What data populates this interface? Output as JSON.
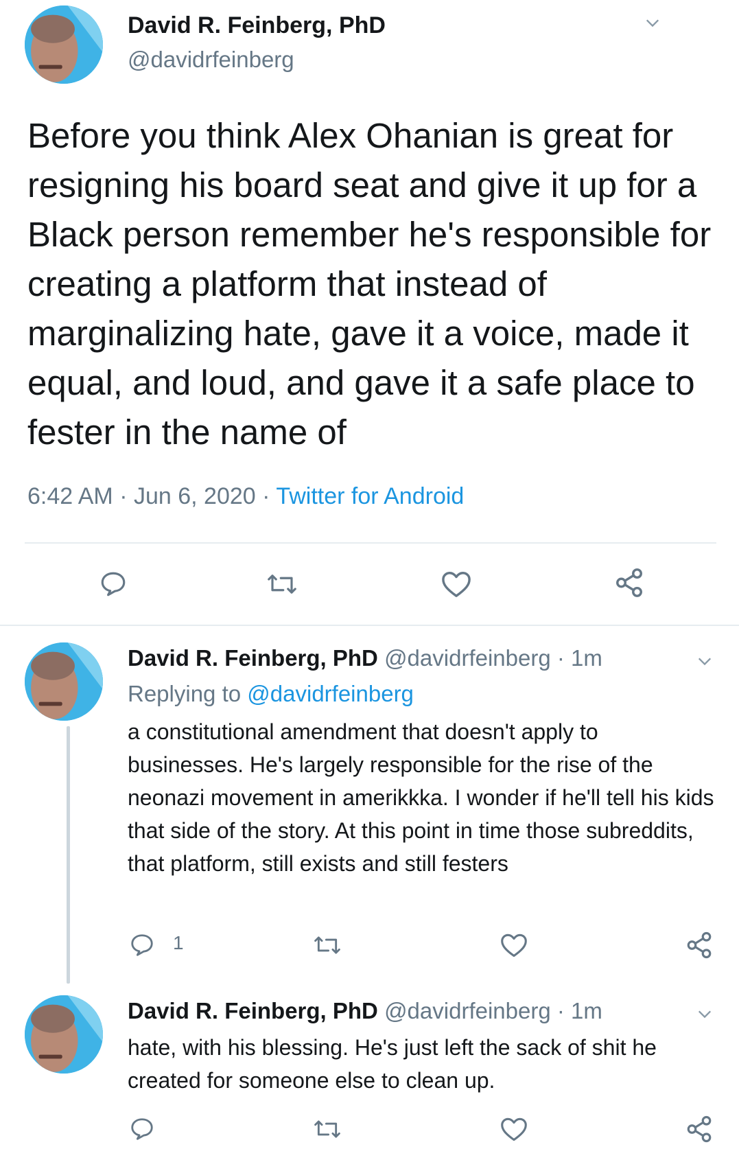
{
  "main_tweet": {
    "author_name": "David R. Feinberg, PhD",
    "author_handle": "@davidrfeinberg",
    "text": "Before you think Alex Ohanian is great for resigning his board seat and give it up for a Black person  remember he's responsible for creating a platform that instead of marginalizing hate, gave it a voice, made it equal, and loud, and gave it a safe place to fester in the name of",
    "time": "6:42 AM",
    "date": "Jun 6, 2020",
    "source": "Twitter for Android",
    "separator": "·"
  },
  "replies": [
    {
      "author_name": "David R. Feinberg, PhD",
      "author_handle": "@davidrfeinberg",
      "separator": "·",
      "age": "1m",
      "replying_label": "Replying to",
      "replying_to": "@davidrfeinberg",
      "text": "a constitutional amendment that doesn't apply to businesses. He's largely responsible for the rise of the neonazi movement in amerikkka. I wonder if he'll tell his kids that side of the story. At this point in time those subreddits, that platform, still exists and still festers",
      "reply_count": "1"
    },
    {
      "author_name": "David R. Feinberg, PhD",
      "author_handle": "@davidrfeinberg",
      "separator": "·",
      "age": "1m",
      "text": "hate, with his blessing.  He's just left the sack of shit he created for someone else to clean up."
    }
  ],
  "icons": {
    "reply": "reply-icon",
    "retweet": "retweet-icon",
    "like": "like-icon",
    "share": "share-icon",
    "more": "chevron-down-icon"
  },
  "colors": {
    "text": "#14171a",
    "secondary": "#657786",
    "link": "#1b95e0",
    "divider": "#e6ecf0",
    "thread_line": "#ccd6dd"
  }
}
